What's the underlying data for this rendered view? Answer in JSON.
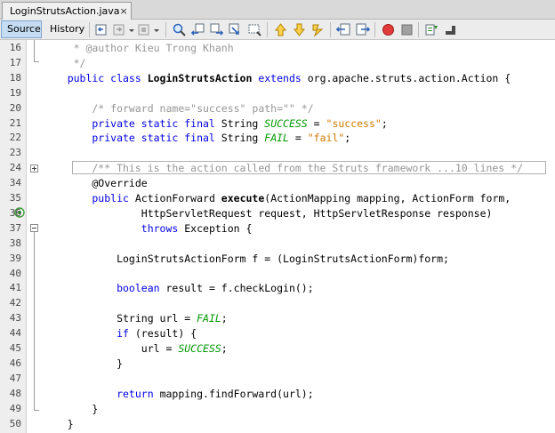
{
  "tab": {
    "filename": "LoginStrutsAction.java",
    "close": "×"
  },
  "toolbar": {
    "source": "Source",
    "history": "History"
  },
  "icons": [
    "back-icon",
    "forward-icon",
    "find-icon",
    "find-previous-icon",
    "find-next-icon",
    "find-selection-icon",
    "toggle-highlight-icon",
    "previous-bookmark-icon",
    "next-bookmark-icon",
    "toggle-bookmark-icon",
    "shift-left-icon",
    "shift-right-icon",
    "start-macro-icon",
    "stop-macro-icon",
    "comment-icon",
    "uncomment-icon"
  ],
  "lines": [
    {
      "n": "16",
      "segs": [
        {
          "c": "cm",
          "t": "     * @author Kieu Trong Khanh"
        }
      ]
    },
    {
      "n": "17",
      "segs": [
        {
          "c": "cm",
          "t": "     */"
        }
      ]
    },
    {
      "n": "18",
      "segs": [
        {
          "c": "kw",
          "t": "    public class "
        },
        {
          "c": "b",
          "t": "LoginStrutsAction"
        },
        {
          "c": "kw",
          "t": " extends "
        },
        {
          "c": "",
          "t": "org.apache.struts.action.Action {"
        }
      ]
    },
    {
      "n": "19",
      "segs": []
    },
    {
      "n": "20",
      "segs": [
        {
          "c": "cm",
          "t": "        /* forward name=\"success\" path=\"\" */"
        }
      ]
    },
    {
      "n": "21",
      "segs": [
        {
          "c": "kw",
          "t": "        private static final "
        },
        {
          "c": "",
          "t": "String "
        },
        {
          "c": "ital",
          "t": "SUCCESS"
        },
        {
          "c": "",
          "t": " = "
        },
        {
          "c": "str",
          "t": "\"success\""
        },
        {
          "c": "",
          "t": ";"
        }
      ]
    },
    {
      "n": "22",
      "segs": [
        {
          "c": "kw",
          "t": "        private static final "
        },
        {
          "c": "",
          "t": "String "
        },
        {
          "c": "ital",
          "t": "FAIL"
        },
        {
          "c": "",
          "t": " = "
        },
        {
          "c": "str",
          "t": "\"fail\""
        },
        {
          "c": "",
          "t": ";"
        }
      ]
    },
    {
      "n": "23",
      "segs": []
    },
    {
      "n": "24",
      "segs": [
        {
          "c": "cm",
          "t": "        /** This is the action called from the Struts framework ...10 lines */"
        }
      ]
    },
    {
      "n": "34",
      "segs": [
        {
          "c": "ann",
          "t": "        @Override"
        }
      ]
    },
    {
      "n": "35",
      "segs": [
        {
          "c": "kw",
          "t": "        public "
        },
        {
          "c": "",
          "t": "ActionForward "
        },
        {
          "c": "b",
          "t": "execute"
        },
        {
          "c": "",
          "t": "(ActionMapping mapping, ActionForm form,"
        }
      ]
    },
    {
      "n": "36",
      "segs": [
        {
          "c": "",
          "t": "                HttpServletRequest request, HttpServletResponse response)"
        }
      ]
    },
    {
      "n": "37",
      "segs": [
        {
          "c": "kw",
          "t": "                throws "
        },
        {
          "c": "",
          "t": "Exception {"
        }
      ]
    },
    {
      "n": "38",
      "segs": []
    },
    {
      "n": "39",
      "segs": [
        {
          "c": "",
          "t": "            LoginStrutsActionForm f = (LoginStrutsActionForm)form;"
        }
      ]
    },
    {
      "n": "40",
      "segs": []
    },
    {
      "n": "41",
      "segs": [
        {
          "c": "kw",
          "t": "            boolean "
        },
        {
          "c": "",
          "t": "result = f.checkLogin();"
        }
      ]
    },
    {
      "n": "42",
      "segs": []
    },
    {
      "n": "43",
      "segs": [
        {
          "c": "",
          "t": "            String url = "
        },
        {
          "c": "ital",
          "t": "FAIL"
        },
        {
          "c": "",
          "t": ";"
        }
      ]
    },
    {
      "n": "44",
      "segs": [
        {
          "c": "kw",
          "t": "            if "
        },
        {
          "c": "",
          "t": "(result) {"
        }
      ]
    },
    {
      "n": "45",
      "segs": [
        {
          "c": "",
          "t": "                url = "
        },
        {
          "c": "ital",
          "t": "SUCCESS"
        },
        {
          "c": "",
          "t": ";"
        }
      ]
    },
    {
      "n": "46",
      "segs": [
        {
          "c": "",
          "t": "            }"
        }
      ]
    },
    {
      "n": "47",
      "segs": []
    },
    {
      "n": "48",
      "segs": [
        {
          "c": "kw",
          "t": "            return "
        },
        {
          "c": "",
          "t": "mapping.findForward(url);"
        }
      ]
    },
    {
      "n": "49",
      "segs": [
        {
          "c": "",
          "t": "        }"
        }
      ]
    },
    {
      "n": "50",
      "segs": [
        {
          "c": "",
          "t": "    }"
        }
      ]
    }
  ]
}
